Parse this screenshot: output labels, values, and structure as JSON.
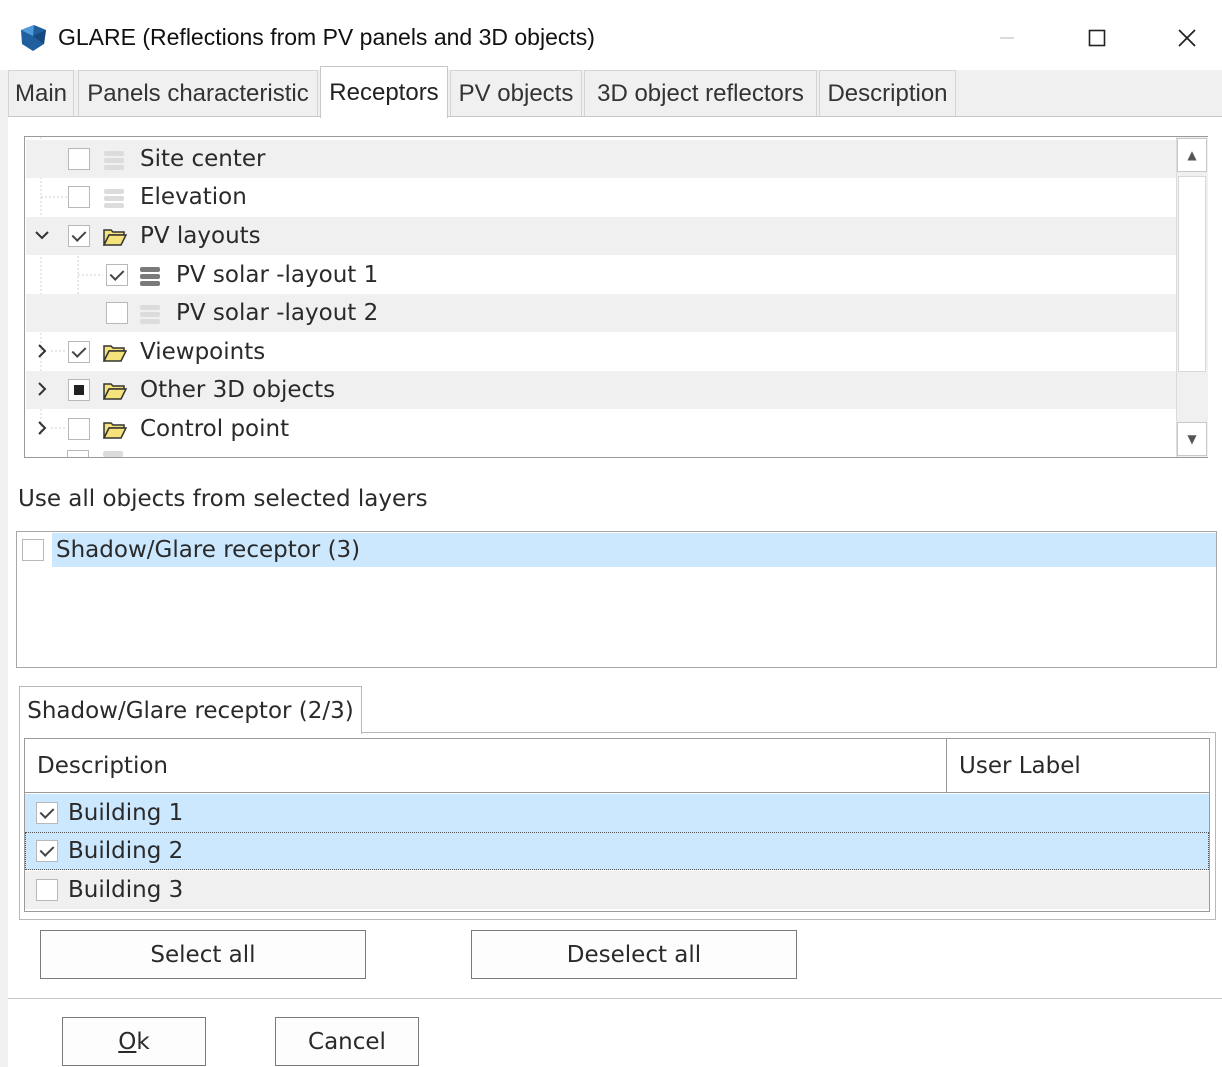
{
  "window": {
    "title": "GLARE (Reflections from PV panels and 3D objects)",
    "icon": "glare-app-icon",
    "controls": [
      "minimize-icon",
      "maximize-icon",
      "close-icon"
    ]
  },
  "tabs": [
    {
      "label": "Main",
      "active": false
    },
    {
      "label": "Panels characteristic",
      "active": false
    },
    {
      "label": "Receptors",
      "active": true
    },
    {
      "label": "PV objects",
      "active": false
    },
    {
      "label": "3D object reflectors",
      "active": false
    },
    {
      "label": "Description",
      "active": false
    }
  ],
  "tree": {
    "items": [
      {
        "label": "Site center",
        "checked": false,
        "icon": "layer-icon",
        "expander": ""
      },
      {
        "label": "Elevation",
        "checked": false,
        "icon": "layer-icon",
        "expander": ""
      },
      {
        "label": "PV layouts",
        "checked": true,
        "icon": "folder-icon",
        "expander": "expanded"
      },
      {
        "label": "PV solar -layout 1",
        "checked": true,
        "icon": "layer-icon",
        "expander": ""
      },
      {
        "label": "PV solar -layout 2",
        "checked": false,
        "icon": "layer-icon",
        "expander": ""
      },
      {
        "label": "Viewpoints",
        "checked": true,
        "icon": "folder-icon",
        "expander": "collapsed"
      },
      {
        "label": "Other 3D objects",
        "checked": "partial",
        "icon": "folder-icon",
        "expander": "collapsed"
      },
      {
        "label": "Control point",
        "checked": false,
        "icon": "folder-icon",
        "expander": "collapsed"
      }
    ]
  },
  "use_all_label": "Use all objects from selected layers",
  "layer_list": {
    "items": [
      {
        "label": "Shadow/Glare receptor (3)",
        "checked": false,
        "selected": true
      }
    ]
  },
  "receptor_tab": {
    "label": "Shadow/Glare receptor (2/3)"
  },
  "grid": {
    "columns": [
      "Description",
      "User Label"
    ],
    "rows": [
      {
        "description": "Building 1",
        "user_label": "",
        "checked": true,
        "selected": true
      },
      {
        "description": "Building 2",
        "user_label": "",
        "checked": true,
        "selected": true
      },
      {
        "description": "Building 3",
        "user_label": "",
        "checked": false,
        "selected": false
      }
    ]
  },
  "buttons": {
    "select_all": "Select all",
    "deselect_all": "Deselect all",
    "ok_mnemonic": "O",
    "ok_rest": "k",
    "cancel": "Cancel"
  },
  "colors": {
    "selection": "#cce8ff",
    "alt_row": "#f0f0f0",
    "folder": "#f5e27a",
    "app_icon": "#1f5f9e"
  }
}
